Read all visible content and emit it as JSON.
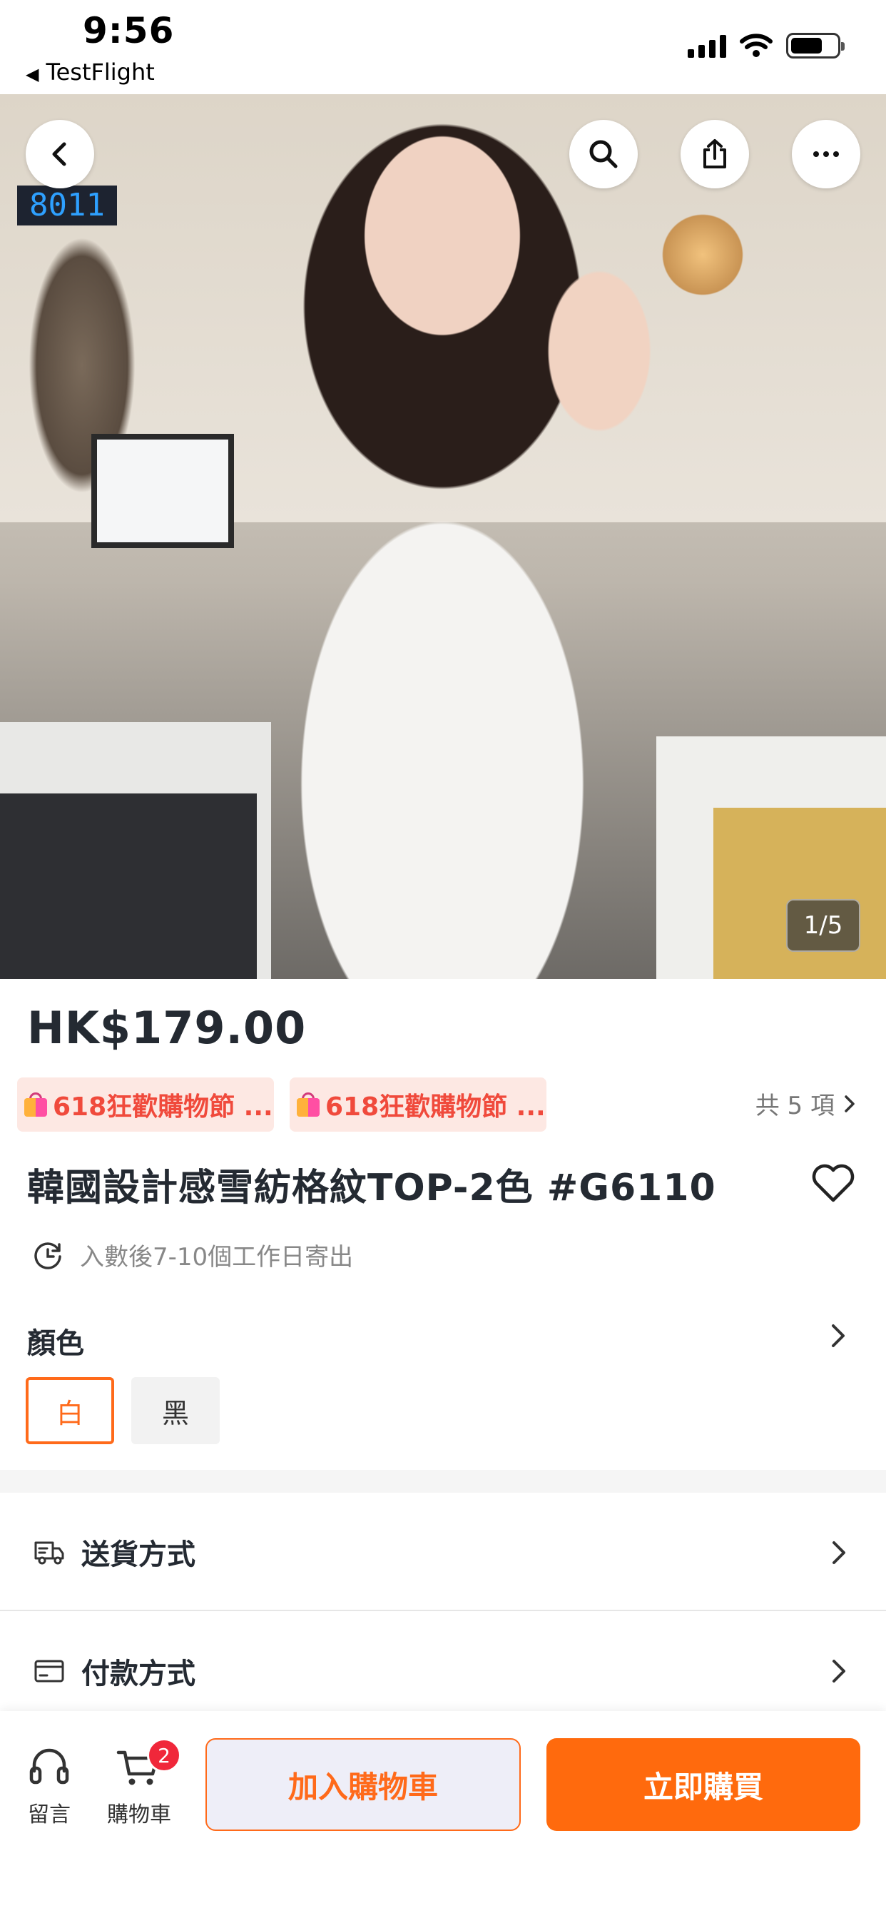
{
  "status_bar": {
    "time": "9:56",
    "back_app": "TestFlight",
    "battery_level": 0.7
  },
  "hero": {
    "image_counter": "1/5",
    "clock_display": "8011"
  },
  "product": {
    "price": "HK$179.00",
    "promotions": [
      "618狂歡購物節 ...",
      "618狂歡購物節 ..."
    ],
    "promotion_count": "共 5 項",
    "title": "韓國設計感雪紡格紋TOP-2色 #G6110",
    "shipping_note": "入數後7-10個工作日寄出"
  },
  "color": {
    "label": "顏色",
    "options": [
      "白",
      "黑"
    ],
    "selected": "白"
  },
  "rows": {
    "delivery": "送貨方式",
    "payment": "付款方式"
  },
  "bottom_bar": {
    "message_label": "留言",
    "cart_label": "購物車",
    "cart_badge": "2",
    "add_to_cart": "加入購物車",
    "buy_now": "立即購買"
  },
  "colors": {
    "accent": "#ff6a0d",
    "promo_text": "#f04a3c",
    "promo_bg": "#fde8e3",
    "badge": "#f0273a"
  }
}
